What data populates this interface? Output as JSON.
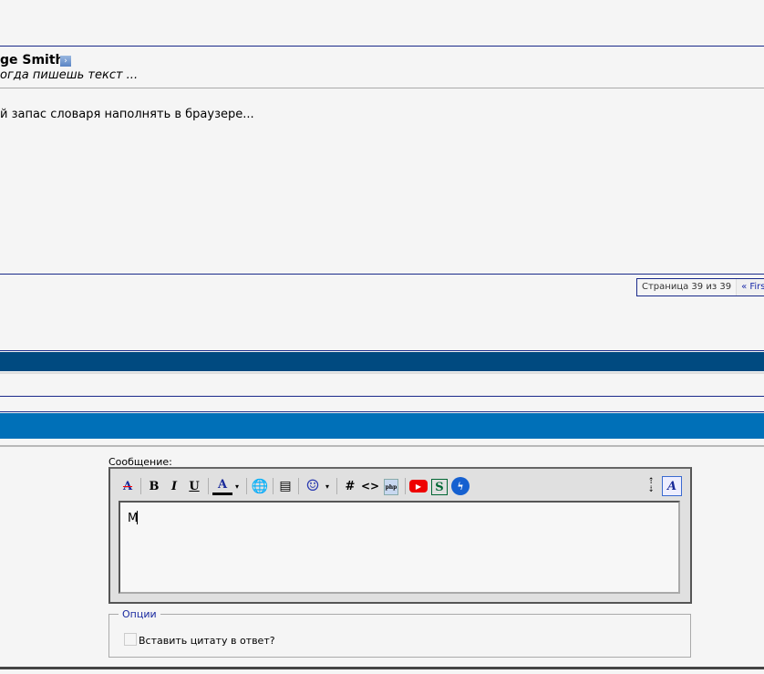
{
  "post": {
    "author": "ge Smith",
    "title": "огда пишешь текст ...",
    "body": "й запас словаря наполнять в браузере..."
  },
  "pagination": {
    "label": "Страница 39 из 39",
    "first": "« First"
  },
  "editor": {
    "label": "Сообщение:",
    "content": "M",
    "toolbar": [
      "remove-format",
      "bold",
      "italic",
      "underline",
      "font-color",
      "insert-link",
      "quote",
      "smilies",
      "hash",
      "code",
      "php",
      "youtube",
      "s",
      "flash",
      "resize",
      "switch-mode"
    ],
    "bold": "B",
    "italic": "I",
    "underline": "U",
    "color_letter": "A",
    "hash": "#",
    "code": "<>",
    "s_letter": "S"
  },
  "options": {
    "legend": "Опции",
    "quote_checkbox": "Вставить цитату в ответ?",
    "quote_checked": false
  }
}
